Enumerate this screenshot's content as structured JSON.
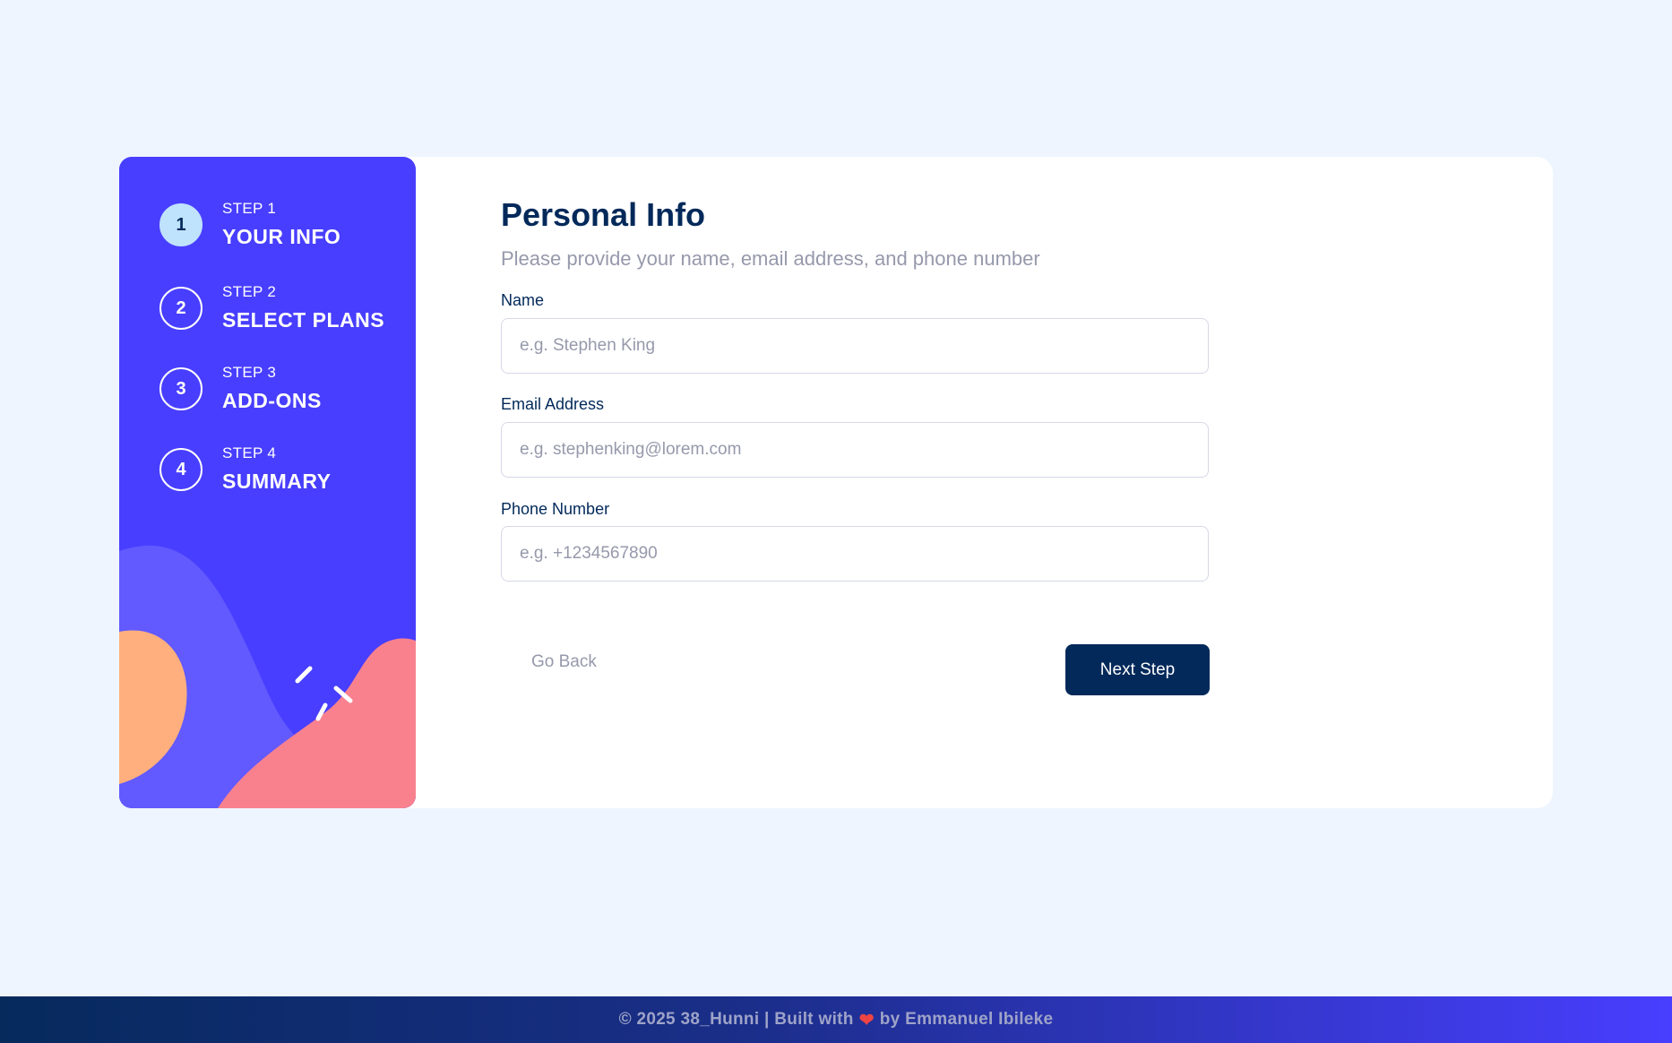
{
  "steps": [
    {
      "number": "1",
      "label": "STEP 1",
      "title": "YOUR INFO",
      "active": true
    },
    {
      "number": "2",
      "label": "STEP 2",
      "title": "SELECT PLANS",
      "active": false
    },
    {
      "number": "3",
      "label": "STEP 3",
      "title": "ADD-ONS",
      "active": false
    },
    {
      "number": "4",
      "label": "STEP 4",
      "title": "SUMMARY",
      "active": false
    }
  ],
  "form": {
    "title": "Personal Info",
    "subtitle": "Please provide your name, email address, and phone number",
    "fields": {
      "name": {
        "label": "Name",
        "placeholder": "e.g. Stephen King",
        "value": ""
      },
      "email": {
        "label": "Email Address",
        "placeholder": "e.g. stephenking@lorem.com",
        "value": ""
      },
      "phone": {
        "label": "Phone Number",
        "placeholder": "e.g. +1234567890",
        "value": ""
      }
    },
    "back_label": "Go Back",
    "next_label": "Next Step"
  },
  "footer": {
    "prefix": "© 2025 38_Hunni | Built with",
    "heart_icon": "heart-icon",
    "suffix": "by Emmanuel Ibileke"
  },
  "colors": {
    "background": "#eef5fe",
    "sidebar": "#483eff",
    "active_step": "#bfe2fd",
    "primary": "#02295a",
    "muted": "#9699ab",
    "heart": "#ef4444"
  }
}
